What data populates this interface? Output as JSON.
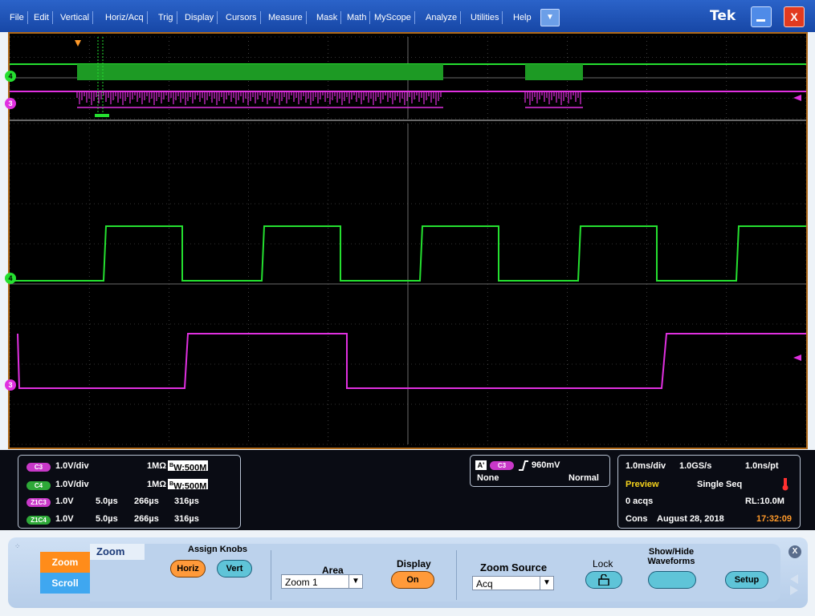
{
  "menubar": {
    "items": [
      "File",
      "Edit",
      "Vertical",
      "Horiz/Acq",
      "Trig",
      "Display",
      "Cursors",
      "Measure",
      "Mask",
      "Math",
      "MyScope",
      "Analyze",
      "Utilities",
      "Help"
    ],
    "logo": "Tek",
    "close_label": "X"
  },
  "markers": {
    "ch4": "4",
    "ch3": "3"
  },
  "readouts": {
    "channels": [
      {
        "badge": "C3",
        "scale": "1.0V/div",
        "impedance": "1MΩ",
        "bw": "W:500M",
        "bw_prefix": "B"
      },
      {
        "badge": "C4",
        "scale": "1.0V/div",
        "impedance": "1MΩ",
        "bw": "W:500M",
        "bw_prefix": "B"
      }
    ],
    "zooms": [
      {
        "badge": "Z1C3",
        "scale": "1.0V",
        "div": "5.0µs",
        "pos1": "266µs",
        "pos2": "316µs"
      },
      {
        "badge": "Z1C4",
        "scale": "1.0V",
        "div": "5.0µs",
        "pos1": "266µs",
        "pos2": "316µs"
      }
    ],
    "trigger": {
      "a_label": "A'",
      "source": "C3",
      "level": "960mV",
      "coupling": "None",
      "mode": "Normal"
    },
    "acquisition": {
      "timebase": "1.0ms/div",
      "rate": "1.0GS/s",
      "resolution": "1.0ns/pt",
      "status": "Preview",
      "mode": "Single Seq",
      "acqs": "0 acqs",
      "record_length": "RL:10.0M",
      "cons": "Cons",
      "date": "August 28, 2018",
      "time": "17:32:09"
    }
  },
  "control_panel": {
    "zoom_tab": "Zoom",
    "scroll_tab": "Scroll",
    "section_title": "Zoom",
    "assign_knobs": "Assign Knobs",
    "horiz": "Horiz",
    "vert": "Vert",
    "area_label": "Area",
    "area_value": "Zoom 1",
    "display_label": "Display",
    "display_value": "On",
    "source_label": "Zoom Source",
    "source_value": "Acq",
    "lock_label": "Lock",
    "show_hide": "Show/Hide",
    "waveforms": "Waveforms",
    "setup": "Setup",
    "close": "X"
  },
  "colors": {
    "ch3": "#e030e0",
    "ch4": "#25e030",
    "grid": "#6a6a6a",
    "accent": "#ff8c1a"
  }
}
